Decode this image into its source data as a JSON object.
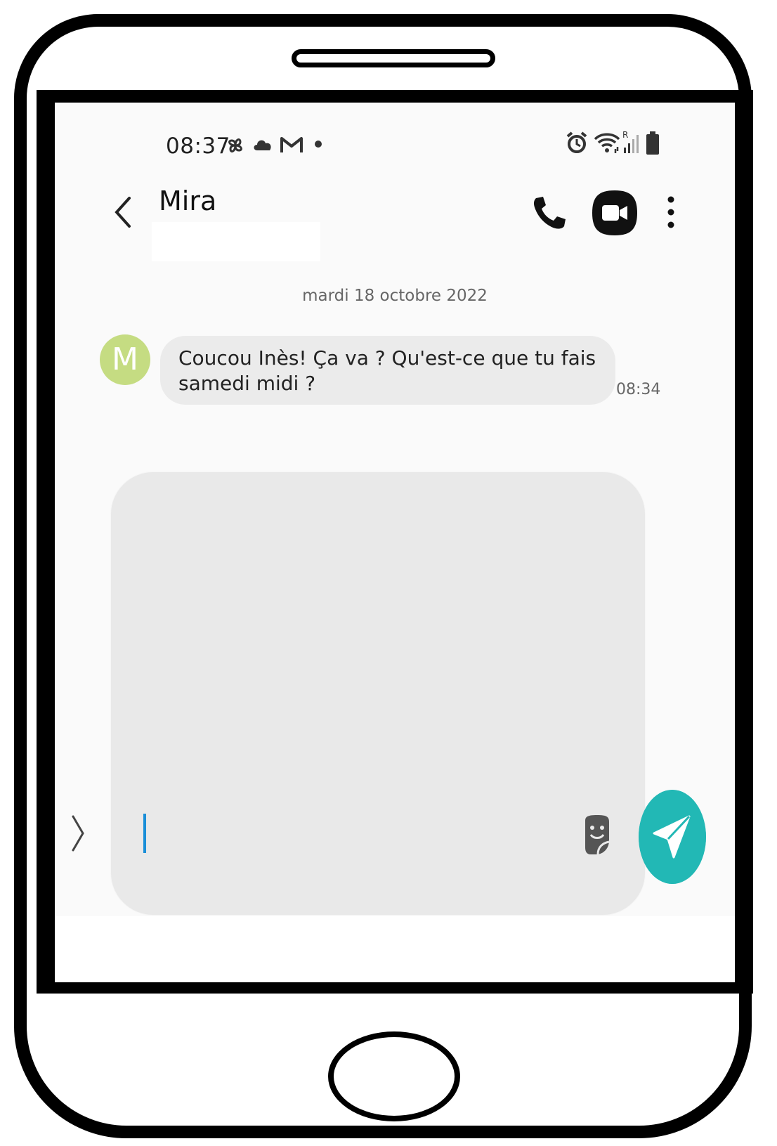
{
  "status_bar": {
    "time": "08:37",
    "left_icons": [
      "pinwheel-icon",
      "cloud-icon",
      "gmail-icon",
      "dot-icon"
    ],
    "right_icons": [
      "alarm-icon",
      "wifi-icon",
      "signal-roaming-icon",
      "battery-icon"
    ]
  },
  "header": {
    "contact_name": "Mira",
    "actions": [
      "back-icon",
      "phone-icon",
      "video-call-icon",
      "more-vert-icon"
    ]
  },
  "conversation": {
    "date": "mardi 18 octobre 2022",
    "messages": [
      {
        "avatar_letter": "M",
        "avatar_color": "#c5dc82",
        "text": "Coucou Inès! Ça va ? Qu'est-ce que tu fais samedi midi ?",
        "time": "08:34"
      }
    ]
  },
  "compose": {
    "value": "",
    "placeholder": "",
    "send_color": "#22b8b5"
  }
}
